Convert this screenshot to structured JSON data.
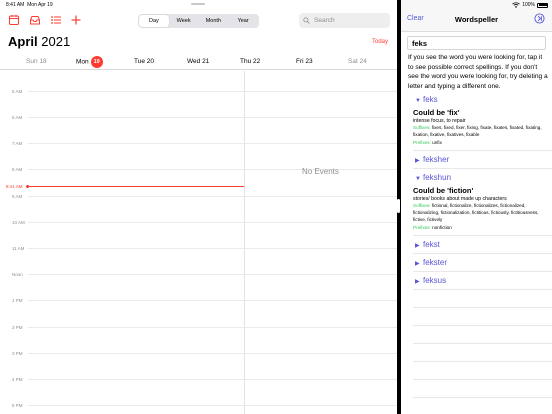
{
  "status": {
    "time": "8:41 AM",
    "date": "Mon Apr 19",
    "battery": "100%"
  },
  "calendar": {
    "view_tabs": [
      "Day",
      "Week",
      "Month",
      "Year"
    ],
    "search_placeholder": "Search",
    "month": "April",
    "year": "2021",
    "today_label": "Today",
    "week_days": [
      {
        "name": "Sun",
        "num": "18"
      },
      {
        "name": "Mon",
        "num": "19"
      },
      {
        "name": "Tue",
        "num": "20"
      },
      {
        "name": "Wed",
        "num": "21"
      },
      {
        "name": "Thu",
        "num": "22"
      },
      {
        "name": "Fri",
        "num": "23"
      },
      {
        "name": "Sat",
        "num": "24"
      }
    ],
    "hours": [
      "5 AM",
      "6 AM",
      "7 AM",
      "8 AM",
      "9 AM",
      "10 AM",
      "11 AM",
      "Noon",
      "1 PM",
      "2 PM",
      "3 PM",
      "4 PM",
      "5 PM"
    ],
    "current_time": "8:41 AM",
    "no_events": "No Events",
    "accent_color": "#ff3b30"
  },
  "wordspeller": {
    "clear_label": "Clear",
    "title": "Wordspeller",
    "input_value": "feks",
    "help_text": "If you see the word you were looking for, tap it to see possible correct spellings. If you don't see the word you were looking for, try deleting a letter and typing a different one.",
    "accent_color": "#5856d6",
    "entries": [
      {
        "word": "feks",
        "expanded": true,
        "heading": "Could be 'fix'",
        "meaning": "intense focus,  to repair",
        "suffixes_label": "Suffixes:",
        "suffixes": "fixes, fixed, fixer, fixing, fixate, fixates, fixated, fixating, fixation, fixative, fixatives, fixable",
        "prefixes_label": "Prefixes:",
        "prefixes": "unfix"
      },
      {
        "word": "feksher",
        "expanded": false
      },
      {
        "word": "fekshun",
        "expanded": true,
        "heading": "Could be 'fiction'",
        "meaning": "stories/ books about made up characters",
        "suffixes_label": "Suffixes:",
        "suffixes": "fictional, fictionalize, fictionalizes, fictionalized, fictionalizing, fictionalization, fictitious, fictiously, fictitiousness, fictive, fictively",
        "prefixes_label": "Prefixes:",
        "prefixes": "nonfiction"
      },
      {
        "word": "fekst",
        "expanded": false
      },
      {
        "word": "fekster",
        "expanded": false
      },
      {
        "word": "feksus",
        "expanded": false
      }
    ]
  }
}
